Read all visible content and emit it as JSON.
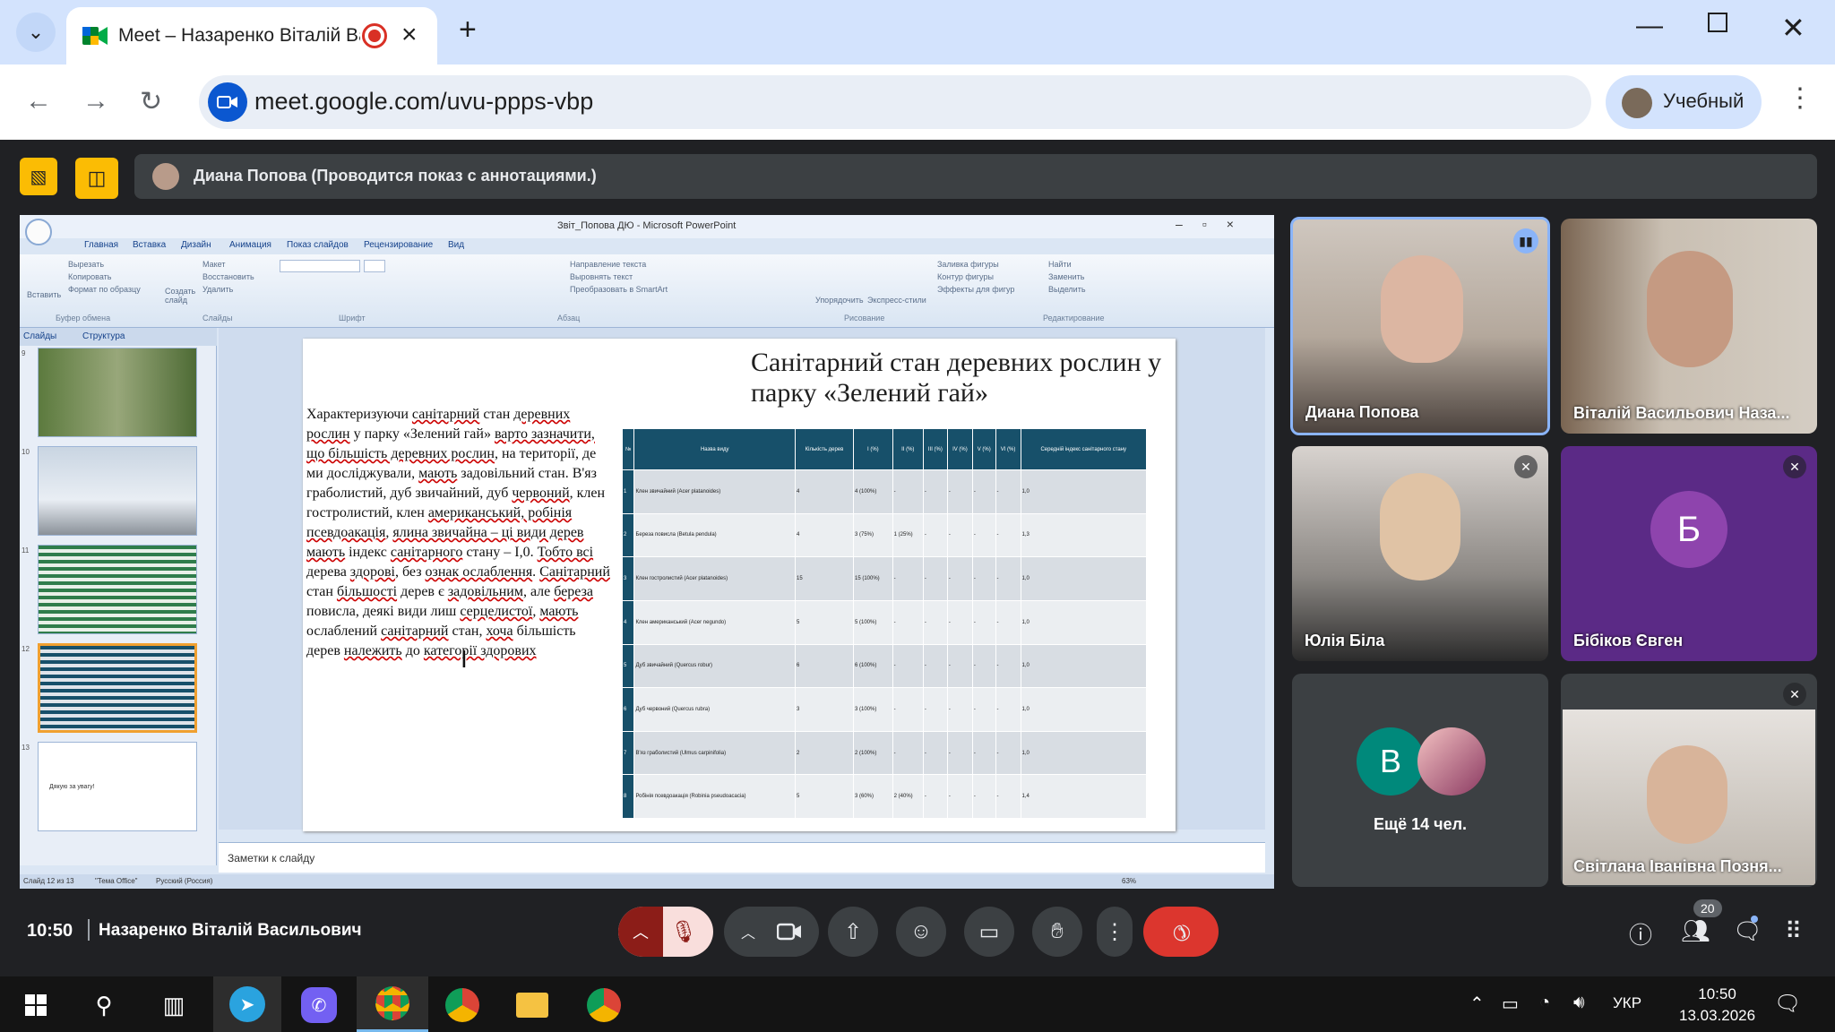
{
  "browser": {
    "tab_title": "Meet – Назаренко Віталій Вас",
    "url": "meet.google.com/uvu-ppps-vbp",
    "profile_name": "Учебный"
  },
  "meet": {
    "presenter_banner": "Диана Попова (Проводится показ с аннотациями.)",
    "participants": [
      {
        "name": "Диана Попова"
      },
      {
        "name": "Віталій Васильович Наза..."
      },
      {
        "name": "Юлія Біла"
      },
      {
        "name": "Бібіков Євген",
        "initial": "Б"
      },
      {
        "name": "Ещё 14 чел.",
        "initial": "В"
      },
      {
        "name": "Світлана Іванівна Позня..."
      }
    ],
    "time": "10:50",
    "meeting_user": "Назаренко Віталій Васильович",
    "people_count": "20"
  },
  "ppt": {
    "window_title": "Звіт_Попова ДЮ - Microsoft PowerPoint",
    "ribbon_tabs": [
      "Главная",
      "Вставка",
      "Дизайн",
      "Анимация",
      "Показ слайдов",
      "Рецензирование",
      "Вид"
    ],
    "ribbon_groups": [
      "Буфер обмена",
      "Слайды",
      "Шрифт",
      "Абзац",
      "Рисование",
      "Редактирование"
    ],
    "clipboard_items": [
      "Вырезать",
      "Копировать",
      "Формат по образцу"
    ],
    "slides_items": [
      "Макет",
      "Восстановить",
      "Удалить"
    ],
    "paragraph_items": [
      "Направление текста",
      "Выровнять текст",
      "Преобразовать в SmartArt"
    ],
    "drawing_items": [
      "Упорядочить",
      "Экспресс-стили",
      "Заливка фигуры",
      "Контур фигуры",
      "Эффекты для фигур"
    ],
    "editing_items": [
      "Найти",
      "Заменить",
      "Выделить"
    ],
    "insert_label": "Вставить",
    "create_slide_label": "Создать слайд",
    "pane_tabs": [
      "Слайды",
      "Структура"
    ],
    "thumb_numbers": [
      "9",
      "10",
      "11",
      "12",
      "13"
    ],
    "thumb13_text": "Дякую за увагу!",
    "notes_placeholder": "Заметки к слайду",
    "status": [
      "Слайд 12 из 13",
      "\"Тема Office\"",
      "Русский (Россия)"
    ],
    "zoom": "63%"
  },
  "slide": {
    "title": "Санітарний стан деревних рослин у парку «Зелений гай»",
    "table_headers": [
      "№",
      "Назва виду",
      "Кількість дерев",
      "I (%)",
      "II (%)",
      "III (%)",
      "IV (%)",
      "V (%)",
      "VI (%)",
      "Середній індекс санітарного стану"
    ],
    "table_rows": [
      [
        "1",
        "Клен звичайний (Acer platanoides)",
        "4",
        "4 (100%)",
        "-",
        "-",
        "-",
        "-",
        "-",
        "1,0"
      ],
      [
        "2",
        "Береза повисла (Betula pendula)",
        "4",
        "3 (75%)",
        "1 (25%)",
        "-",
        "-",
        "-",
        "-",
        "1,3"
      ],
      [
        "3",
        "Клен гостролистий (Acer platanoides)",
        "15",
        "15 (100%)",
        "-",
        "-",
        "-",
        "-",
        "-",
        "1,0"
      ],
      [
        "4",
        "Клен американський (Acer negundo)",
        "5",
        "5 (100%)",
        "-",
        "-",
        "-",
        "-",
        "-",
        "1,0"
      ],
      [
        "5",
        "Дуб звичайний (Quercus robur)",
        "6",
        "6 (100%)",
        "-",
        "-",
        "-",
        "-",
        "-",
        "1,0"
      ],
      [
        "6",
        "Дуб червоний (Quercus rubra)",
        "3",
        "3 (100%)",
        "-",
        "-",
        "-",
        "-",
        "-",
        "1,0"
      ],
      [
        "7",
        "В'яз граболистий (Ulmus carpinifolia)",
        "2",
        "2 (100%)",
        "-",
        "-",
        "-",
        "-",
        "-",
        "1,0"
      ],
      [
        "8",
        "Робінія псевдоакація (Robinia pseudoacacia)",
        "5",
        "3 (60%)",
        "2 (40%)",
        "-",
        "-",
        "-",
        "-",
        "1,4"
      ]
    ]
  },
  "taskbar": {
    "lang": "УКР",
    "time": "10:50",
    "date": "13.03.2026"
  }
}
